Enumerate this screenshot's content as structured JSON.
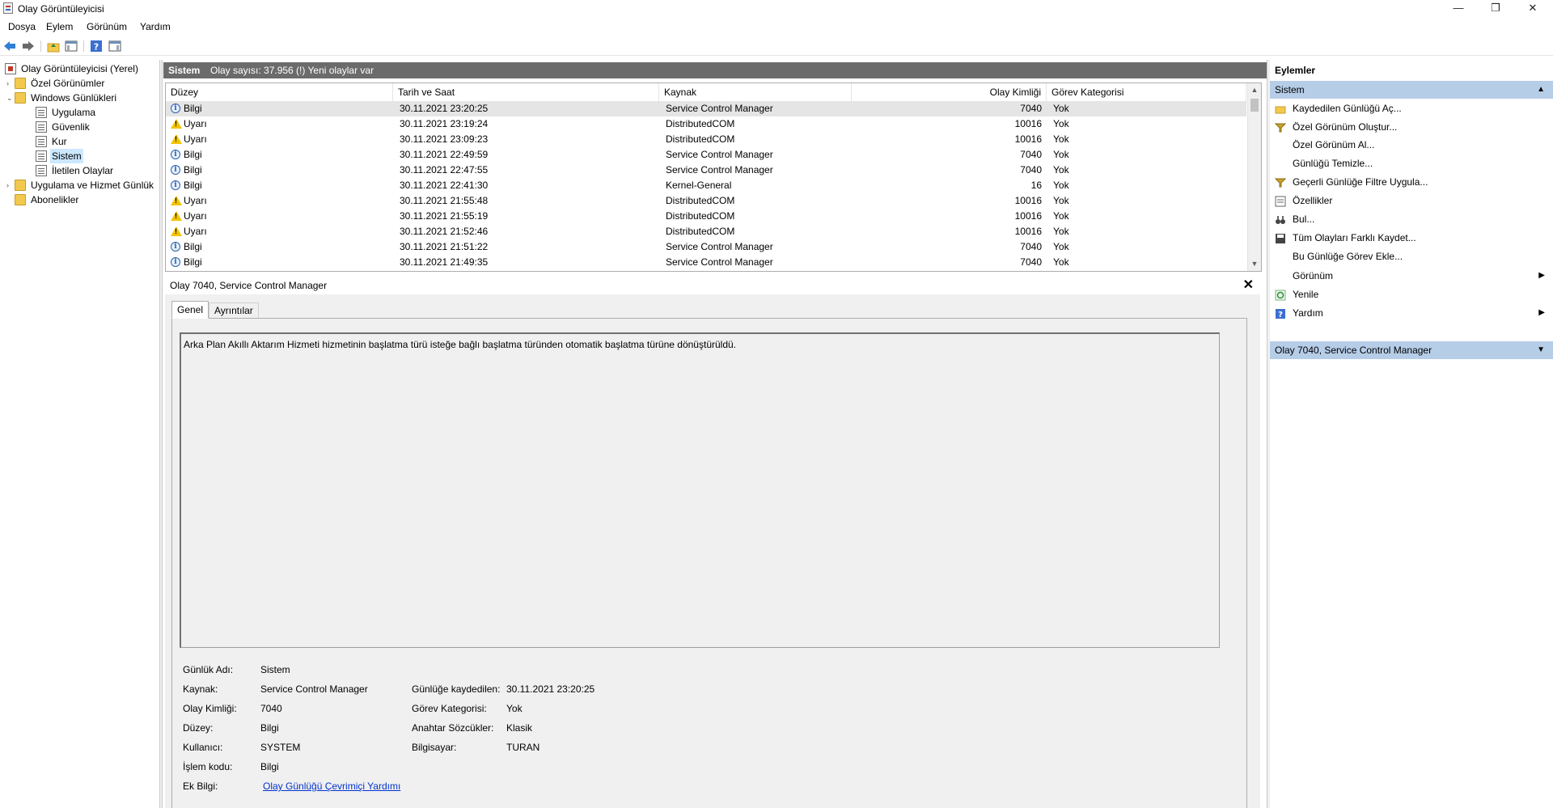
{
  "window": {
    "title": "Olay Görüntüleyicisi",
    "minimize_glyph": "—",
    "restore_glyph": "❐",
    "close_glyph": "✕"
  },
  "menu": [
    "Dosya",
    "Eylem",
    "Görünüm",
    "Yardım"
  ],
  "tree": {
    "root": "Olay Görüntüleyicisi (Yerel)",
    "custom_views": "Özel Görünümler",
    "windows_logs": "Windows Günlükleri",
    "logs": [
      "Uygulama",
      "Güvenlik",
      "Kur",
      "Sistem",
      "İletilen Olaylar"
    ],
    "app_service_logs": "Uygulama ve Hizmet Günlük",
    "subscriptions": "Abonelikler"
  },
  "center": {
    "log_name": "Sistem",
    "summary": "Olay sayısı: 37.956 (!) Yeni olaylar var"
  },
  "events": {
    "columns": [
      "Düzey",
      "Tarih ve Saat",
      "Kaynak",
      "Olay Kimliği",
      "Görev Kategorisi"
    ],
    "rows": [
      {
        "level": "Bilgi",
        "type": "info",
        "date": "30.11.2021 23:20:25",
        "source": "Service Control Manager",
        "id": "7040",
        "category": "Yok"
      },
      {
        "level": "Uyarı",
        "type": "warn",
        "date": "30.11.2021 23:19:24",
        "source": "DistributedCOM",
        "id": "10016",
        "category": "Yok"
      },
      {
        "level": "Uyarı",
        "type": "warn",
        "date": "30.11.2021 23:09:23",
        "source": "DistributedCOM",
        "id": "10016",
        "category": "Yok"
      },
      {
        "level": "Bilgi",
        "type": "info",
        "date": "30.11.2021 22:49:59",
        "source": "Service Control Manager",
        "id": "7040",
        "category": "Yok"
      },
      {
        "level": "Bilgi",
        "type": "info",
        "date": "30.11.2021 22:47:55",
        "source": "Service Control Manager",
        "id": "7040",
        "category": "Yok"
      },
      {
        "level": "Bilgi",
        "type": "info",
        "date": "30.11.2021 22:41:30",
        "source": "Kernel-General",
        "id": "16",
        "category": "Yok"
      },
      {
        "level": "Uyarı",
        "type": "warn",
        "date": "30.11.2021 21:55:48",
        "source": "DistributedCOM",
        "id": "10016",
        "category": "Yok"
      },
      {
        "level": "Uyarı",
        "type": "warn",
        "date": "30.11.2021 21:55:19",
        "source": "DistributedCOM",
        "id": "10016",
        "category": "Yok"
      },
      {
        "level": "Uyarı",
        "type": "warn",
        "date": "30.11.2021 21:52:46",
        "source": "DistributedCOM",
        "id": "10016",
        "category": "Yok"
      },
      {
        "level": "Bilgi",
        "type": "info",
        "date": "30.11.2021 21:51:22",
        "source": "Service Control Manager",
        "id": "7040",
        "category": "Yok"
      },
      {
        "level": "Bilgi",
        "type": "info",
        "date": "30.11.2021 21:49:35",
        "source": "Service Control Manager",
        "id": "7040",
        "category": "Yok"
      }
    ]
  },
  "detail": {
    "title": "Olay 7040, Service Control Manager",
    "tabs": [
      "Genel",
      "Ayrıntılar"
    ],
    "description": "Arka Plan Akıllı Aktarım Hizmeti hizmetinin başlatma türü isteğe bağlı başlatma türünden otomatik başlatma türüne dönüştürüldü.",
    "fields": {
      "log_name_label": "Günlük Adı:",
      "log_name": "Sistem",
      "source_label": "Kaynak:",
      "source": "Service Control Manager",
      "logged_label": "Günlüğe kaydedilen:",
      "logged": "30.11.2021 23:20:25",
      "event_id_label": "Olay Kimliği:",
      "event_id": "7040",
      "task_label": "Görev Kategorisi:",
      "task": "Yok",
      "level_label": "Düzey:",
      "level": "Bilgi",
      "keywords_label": "Anahtar Sözcükler:",
      "keywords": "Klasik",
      "user_label": "Kullanıcı:",
      "user": "SYSTEM",
      "computer_label": "Bilgisayar:",
      "computer": "TURAN",
      "opcode_label": "İşlem kodu:",
      "opcode": "Bilgi",
      "more_info_label": "Ek Bilgi:",
      "more_info_link": "Olay Günlüğü Çevrimiçi Yardımı"
    }
  },
  "actions": {
    "title": "Eylemler",
    "section1": "Sistem",
    "items": [
      {
        "label": "Kaydedilen Günlüğü Aç...",
        "icon": "open-folder-icon"
      },
      {
        "label": "Özel Görünüm Oluştur...",
        "icon": "filter-icon"
      },
      {
        "label": "Özel Görünüm Al...",
        "icon": ""
      },
      {
        "label": "Günlüğü Temizle...",
        "icon": ""
      },
      {
        "label": "Geçerli Günlüğe Filtre Uygula...",
        "icon": "filter-icon"
      },
      {
        "label": "Özellikler",
        "icon": "properties-icon"
      },
      {
        "label": "Bul...",
        "icon": "binoculars-icon"
      },
      {
        "label": "Tüm Olayları Farklı Kaydet...",
        "icon": "save-icon"
      },
      {
        "label": "Bu Günlüğe Görev Ekle...",
        "icon": ""
      },
      {
        "label": "Görünüm",
        "icon": ""
      },
      {
        "label": "Yenile",
        "icon": "refresh-icon"
      },
      {
        "label": "Yardım",
        "icon": "help-icon"
      }
    ],
    "section2": "Olay 7040, Service Control Manager"
  },
  "colors": {
    "header_gray": "#6b6b6b",
    "section_blue": "#b6cde8",
    "selected_row": "#e5e5e5",
    "link": "#0033cc"
  }
}
